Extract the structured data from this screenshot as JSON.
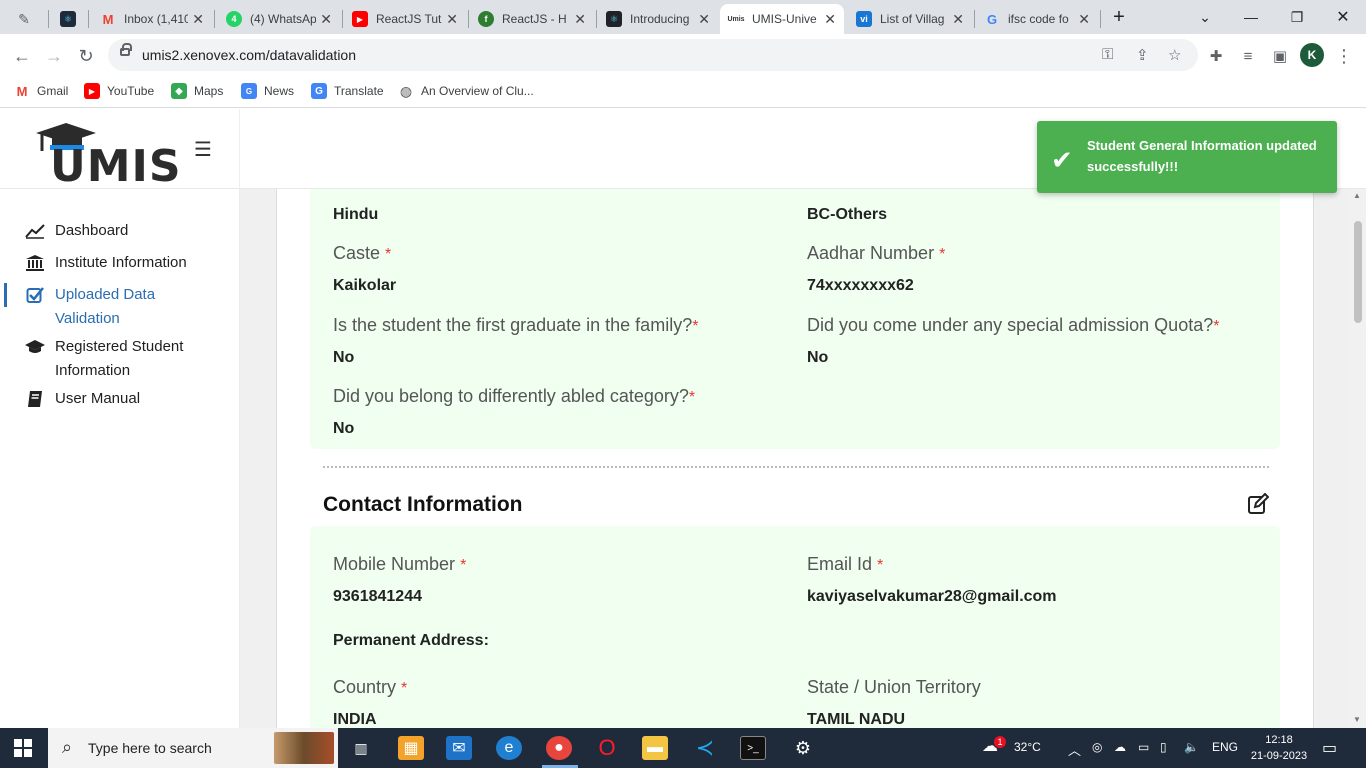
{
  "browser": {
    "tabs": [
      {
        "label": "",
        "fav_color": "#5f6368",
        "fav_char": "✎"
      },
      {
        "label": "",
        "fav_color": "#1f2b3a",
        "fav_char": "⚛"
      },
      {
        "label": "Inbox (1,410",
        "fav_color": "#ea4335",
        "fav_char": "M"
      },
      {
        "label": "(4) WhatsAp",
        "fav_color": "#25d366",
        "fav_char": "4"
      },
      {
        "label": "ReactJS Tut",
        "fav_color": "#ff0000",
        "fav_char": "▶"
      },
      {
        "label": "ReactJS - H",
        "fav_color": "#2e7d32",
        "fav_char": "f"
      },
      {
        "label": "Introducing",
        "fav_color": "#20232a",
        "fav_char": "⚛"
      },
      {
        "label": "UMIS-Unive",
        "fav_color": "#ffffff",
        "fav_char": "U"
      },
      {
        "label": "List of Villag",
        "fav_color": "#1976d2",
        "fav_char": "vi"
      },
      {
        "label": "ifsc code fo",
        "fav_color": "#ffffff",
        "fav_char": "G"
      }
    ],
    "new_tab": "+",
    "url": "umis2.xenovex.com/datavalidation",
    "profile_initial": "K"
  },
  "bookmarks": [
    {
      "label": "Gmail"
    },
    {
      "label": "YouTube"
    },
    {
      "label": "Maps"
    },
    {
      "label": "News"
    },
    {
      "label": "Translate"
    },
    {
      "label": "An Overview of Clu..."
    }
  ],
  "app": {
    "logo_text": "UMIS",
    "menu_icon": "☰"
  },
  "sidebar": {
    "items": [
      {
        "label": "Dashboard",
        "icon": "chart-line-icon"
      },
      {
        "label": "Institute Information",
        "icon": "institution-icon"
      },
      {
        "label": "Uploaded Data Validation",
        "icon": "checkbox-icon",
        "active": true
      },
      {
        "label": "Registered Student Information",
        "icon": "graduation-cap-icon"
      },
      {
        "label": "User Manual",
        "icon": "book-icon"
      }
    ]
  },
  "general": {
    "religion_value": "Hindu",
    "community_value": "BC-Others",
    "caste_label": "Caste",
    "caste_value": "Kaikolar",
    "aadhar_label": "Aadhar Number",
    "aadhar_value": "74xxxxxxxx62",
    "first_grad_label": "Is the student the first graduate in the family?",
    "first_grad_value": "No",
    "quota_label": "Did you come under any special admission Quota?",
    "quota_value": "No",
    "diff_abled_label": "Did you belong to differently abled category?",
    "diff_abled_value": "No"
  },
  "contact": {
    "title": "Contact Information",
    "mobile_label": "Mobile Number",
    "mobile_value": "9361841244",
    "email_label": "Email Id",
    "email_value": "kaviyaselvakumar28@gmail.com",
    "perm_address_label": "Permanent Address:",
    "country_label": "Country",
    "country_value": "INDIA",
    "state_label": "State / Union Territory",
    "state_value": "TAMIL NADU"
  },
  "toast": {
    "message": "Student General Information updated successfully!!!"
  },
  "taskbar": {
    "search_placeholder": "Type here to search",
    "weather": "32°C",
    "language": "ENG",
    "time": "12:18",
    "date": "21-09-2023",
    "weather_badge": "1"
  },
  "colors": {
    "accent": "#2a6db2",
    "card_bg": "#f0fff0",
    "toast_bg": "#4caf50",
    "required": "#e53935"
  }
}
